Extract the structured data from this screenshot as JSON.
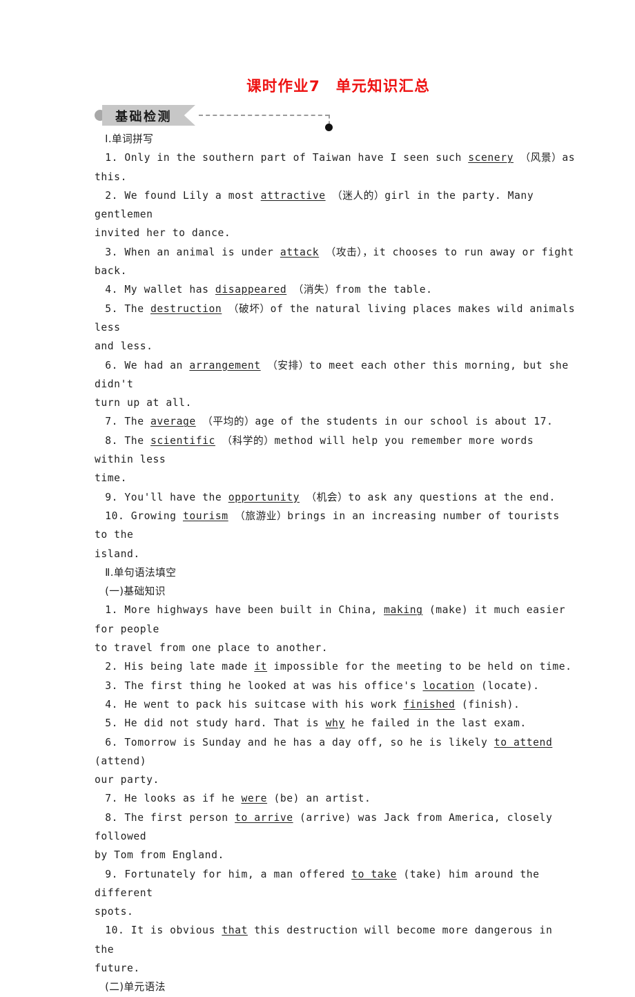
{
  "header": {
    "title": "课时作业7　单元知识汇总"
  },
  "banner": {
    "label": "基础检测"
  },
  "sections": [
    {
      "heading": "Ⅰ.单词拼写",
      "items": [
        {
          "number": "1.",
          "before": "Only in the southern part of Taiwan have I seen such ",
          "answer": "scenery",
          "after": "（风景）as this."
        },
        {
          "number": "2.",
          "before": "We found Lily a most ",
          "answer": "attractive",
          "after": "（迷人的）girl in the party. Many gentlemen invited her to dance."
        },
        {
          "number": "3.",
          "before": "When an animal is under ",
          "answer": "attack",
          "after": "（攻击），it chooses to run away or fight back."
        },
        {
          "number": "4.",
          "before": "My wallet has ",
          "answer": "disappeared",
          "after": "（消失）from the table."
        },
        {
          "number": "5.",
          "before": "The ",
          "answer": "destruction",
          "after": "（破坏）of the natural living places makes wild animals less and less."
        },
        {
          "number": "6.",
          "before": "We had an ",
          "answer": "arrangement",
          "after": "（安排）to meet each other this morning, but she didn't turn up at all."
        },
        {
          "number": "7.",
          "before": "The ",
          "answer": "average",
          "after": "（平均的）age of the students in our school is about 17."
        },
        {
          "number": "8.",
          "before": "The ",
          "answer": "scientific",
          "after": "（科学的）method will help you remember more words within less time."
        },
        {
          "number": "9.",
          "before": "You'll have the ",
          "answer": "opportunity",
          "after": "（机会）to ask any questions at the end."
        },
        {
          "number": "10.",
          "before": "Growing ",
          "answer": "tourism",
          "after": "（旅游业）brings in an increasing number of tourists to the island."
        }
      ]
    },
    {
      "heading": "Ⅱ.单句语法填空",
      "subheading_one": "(一)基础知识",
      "subheading_two": "(二)单元语法",
      "items": [
        {
          "number": "1.",
          "before": "More highways have been built in China, ",
          "answer": "making",
          "after": "(make) it much easier for people to travel from one place to another."
        },
        {
          "number": "2.",
          "before": "His being late made ",
          "answer": "it",
          "after": " impossible for the meeting to be held on time."
        },
        {
          "number": "3.",
          "before": "The first thing he looked at was his office's ",
          "answer": "location",
          "after": " (locate)."
        },
        {
          "number": "4.",
          "before": "He went to pack his suitcase with his work ",
          "answer": "finished",
          "after": " (finish)."
        },
        {
          "number": "5.",
          "before": "He did not study hard. That is ",
          "answer": "why",
          "after": " he failed in the last exam."
        },
        {
          "number": "6.",
          "before": "Tomorrow is Sunday and he has a day off, so he is likely ",
          "answer": "to attend",
          "after": " (attend) our party."
        },
        {
          "number": "7.",
          "before": "He looks as if he ",
          "answer": "were",
          "after": " (be) an artist."
        },
        {
          "number": "8.",
          "before": "The first person ",
          "answer": "to arrive",
          "after": " (arrive) was Jack from America, closely followed by Tom from England."
        },
        {
          "number": "9.",
          "before": "Fortunately for him, a man offered ",
          "answer": "to take",
          "after": " (take) him around the different spots."
        },
        {
          "number": "10.",
          "before": "It is obvious ",
          "answer": "that",
          "after": " this destruction will become more dangerous in the future."
        }
      ]
    }
  ],
  "lines": [
    {
      "id": "l1",
      "kind": "cn",
      "text": "　Ⅰ.单词拼写"
    },
    {
      "id": "l2",
      "kind": "en",
      "pre": "　1. Only in the southern part of Taiwan have I seen such ",
      "u": "scenery",
      "post": " （风景）as"
    },
    {
      "id": "l3",
      "kind": "en",
      "pre": "this.",
      "u": "",
      "post": ""
    },
    {
      "id": "l4",
      "kind": "en",
      "pre": "　2. We found Lily a most ",
      "u": "attractive",
      "post": " （迷人的）girl in the party. Many gentlemen"
    },
    {
      "id": "l5",
      "kind": "en",
      "pre": "invited her to dance.",
      "u": "",
      "post": ""
    },
    {
      "id": "l6",
      "kind": "en",
      "pre": "　3. When an animal is under ",
      "u": "attack",
      "post": " （攻击），it chooses to run away or fight"
    },
    {
      "id": "l7",
      "kind": "en",
      "pre": "back.",
      "u": "",
      "post": ""
    },
    {
      "id": "l8",
      "kind": "en",
      "pre": "　4. My wallet has ",
      "u": "disappeared",
      "post": " （消失）from the table."
    },
    {
      "id": "l9",
      "kind": "en",
      "pre": "　5. The ",
      "u": "destruction",
      "post": " （破坏）of the natural living places makes wild animals less"
    },
    {
      "id": "l10",
      "kind": "en",
      "pre": "and less.",
      "u": "",
      "post": ""
    },
    {
      "id": "l11",
      "kind": "en",
      "pre": "　6. We had an ",
      "u": "arrangement",
      "post": " （安排）to meet each other this morning, but she didn't"
    },
    {
      "id": "l12",
      "kind": "en",
      "pre": "turn up at all.",
      "u": "",
      "post": ""
    },
    {
      "id": "l13",
      "kind": "en",
      "pre": "　7. The ",
      "u": "average",
      "post": " （平均的）age of the students in our school is about 17."
    },
    {
      "id": "l14",
      "kind": "en",
      "pre": "　8. The ",
      "u": "scientific",
      "post": " （科学的）method will help you remember more words within less"
    },
    {
      "id": "l15",
      "kind": "en",
      "pre": "time.",
      "u": "",
      "post": ""
    },
    {
      "id": "l16",
      "kind": "en",
      "pre": "　9. You'll have the ",
      "u": "opportunity",
      "post": " （机会）to ask any questions at the end."
    },
    {
      "id": "l17",
      "kind": "en",
      "pre": "　10. Growing ",
      "u": "tourism",
      "post": " （旅游业）brings in an increasing number of tourists to the"
    },
    {
      "id": "l18",
      "kind": "en",
      "pre": "island.",
      "u": "",
      "post": ""
    },
    {
      "id": "l19",
      "kind": "cn",
      "text": "　Ⅱ.单句语法填空"
    },
    {
      "id": "l20",
      "kind": "cn",
      "text": "　(一)基础知识"
    },
    {
      "id": "l21",
      "kind": "en",
      "pre": "　1. More highways have been built in China, ",
      "u": "making",
      "post": " (make) it much easier for people"
    },
    {
      "id": "l22",
      "kind": "en",
      "pre": "to travel from one place to another.",
      "u": "",
      "post": ""
    },
    {
      "id": "l23",
      "kind": "en",
      "pre": "　2. His being late made ",
      "u": "it",
      "post": " impossible for the meeting to be held on time."
    },
    {
      "id": "l24",
      "kind": "en",
      "pre": "　3. The first thing he looked at was his office's ",
      "u": "location",
      "post": " (locate)."
    },
    {
      "id": "l25",
      "kind": "en",
      "pre": "　4. He went to pack his suitcase with his work ",
      "u": "finished",
      "post": " (finish)."
    },
    {
      "id": "l26",
      "kind": "en",
      "pre": "　5. He did not study hard. That is ",
      "u": "why",
      "post": " he failed in the last exam."
    },
    {
      "id": "l27",
      "kind": "en",
      "pre": "　6. Tomorrow is Sunday and he has a day off, so he is likely ",
      "u": "to attend",
      "post": " (attend)"
    },
    {
      "id": "l28",
      "kind": "en",
      "pre": "our party.",
      "u": "",
      "post": ""
    },
    {
      "id": "l29",
      "kind": "en",
      "pre": "　7. He looks as if he ",
      "u": "were",
      "post": " (be) an artist."
    },
    {
      "id": "l30",
      "kind": "en",
      "pre": "　8. The first person ",
      "u": "to arrive",
      "post": " (arrive) was Jack from America, closely followed"
    },
    {
      "id": "l31",
      "kind": "en",
      "pre": "by Tom from England.",
      "u": "",
      "post": ""
    },
    {
      "id": "l32",
      "kind": "en",
      "pre": "　9. Fortunately for him, a man offered ",
      "u": "to take",
      "post": " (take) him around the different"
    },
    {
      "id": "l33",
      "kind": "en",
      "pre": "spots.",
      "u": "",
      "post": ""
    },
    {
      "id": "l34",
      "kind": "en",
      "pre": "　10. It is obvious ",
      "u": "that",
      "post": " this destruction will become more dangerous in the"
    },
    {
      "id": "l35",
      "kind": "en",
      "pre": "future.",
      "u": "",
      "post": ""
    },
    {
      "id": "l36",
      "kind": "cn",
      "text": "　(二)单元语法"
    }
  ],
  "colors": {
    "title_red": "#ee1111",
    "banner_gray": "#c7c7c7",
    "banner_dot_gray": "#a8a8a8",
    "dash_gray": "#9a9a9a",
    "end_dot": "#111111",
    "text": "#1f1f1f",
    "page_bg": "#ffffff"
  }
}
